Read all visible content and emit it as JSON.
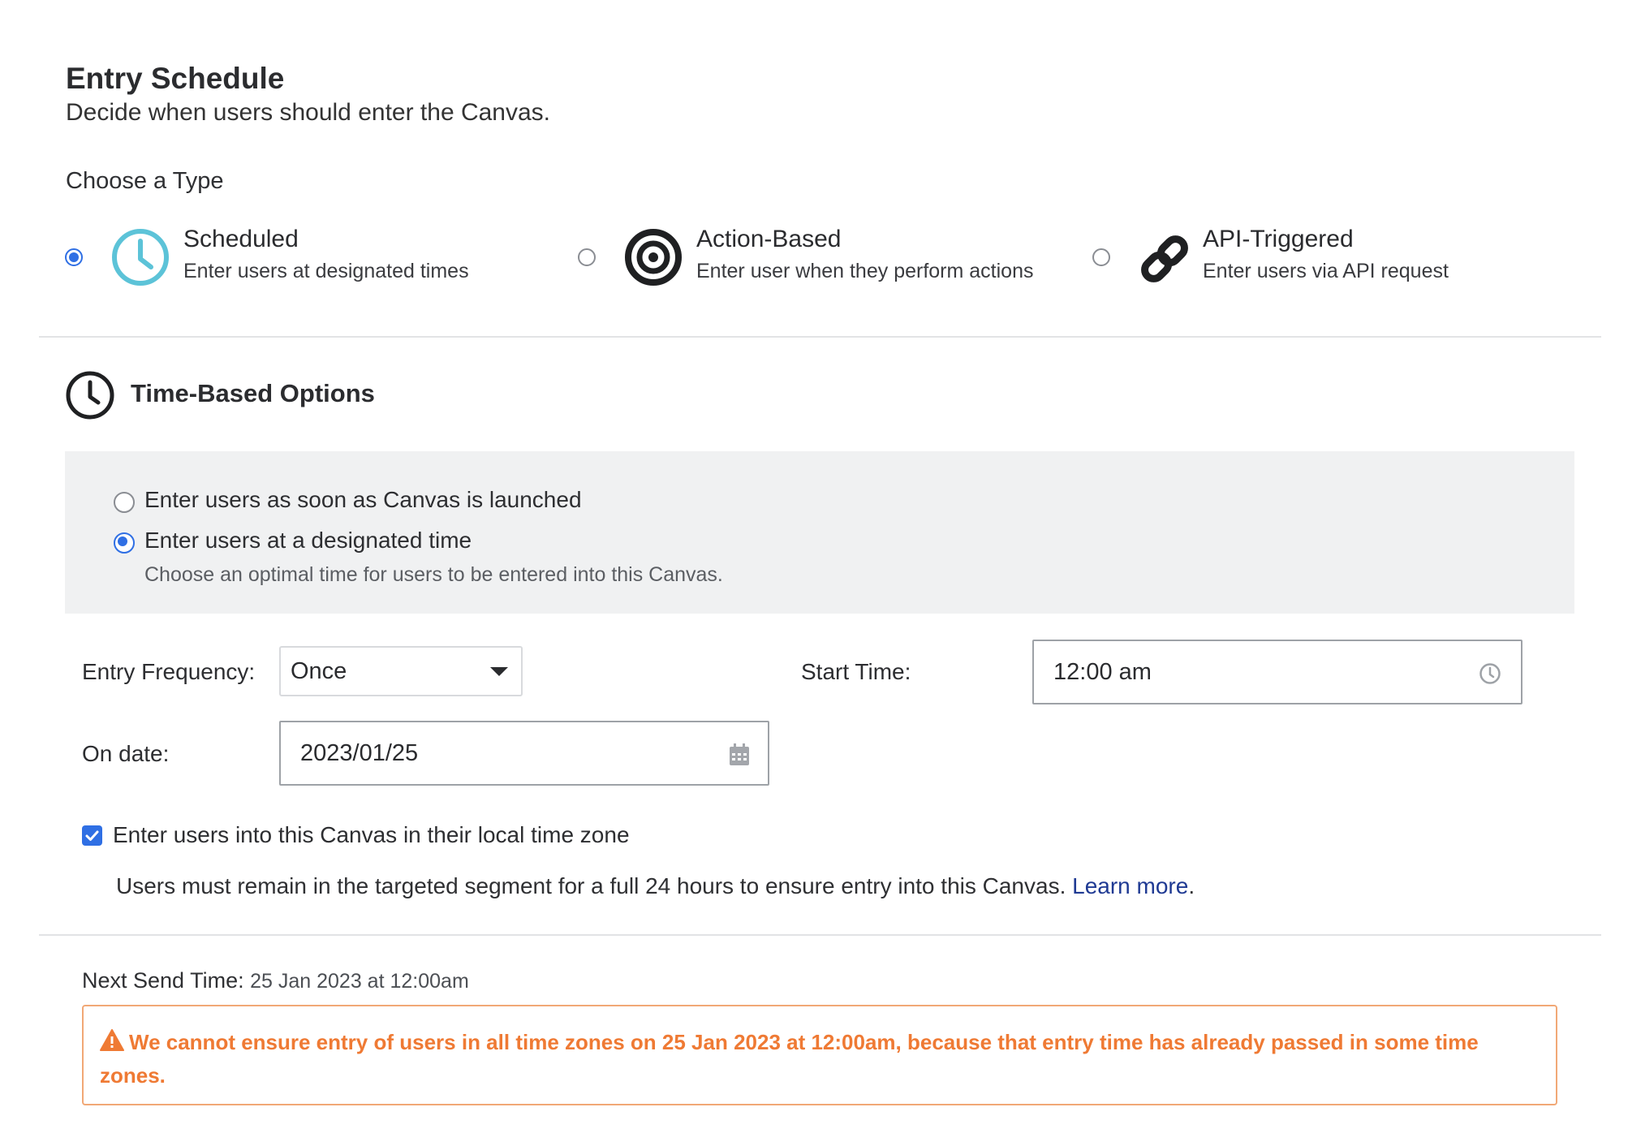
{
  "header": {
    "title": "Entry Schedule",
    "subtitle": "Decide when users should enter the Canvas."
  },
  "type_section": {
    "label": "Choose a Type",
    "options": [
      {
        "title": "Scheduled",
        "description": "Enter users at designated times",
        "icon": "clock-icon",
        "selected": true
      },
      {
        "title": "Action-Based",
        "description": "Enter user when they perform actions",
        "icon": "target-icon",
        "selected": false
      },
      {
        "title": "API-Triggered",
        "description": "Enter users via API request",
        "icon": "link-icon",
        "selected": false
      }
    ]
  },
  "time_options": {
    "title": "Time-Based Options",
    "choices": [
      {
        "label": "Enter users as soon as Canvas is launched",
        "selected": false
      },
      {
        "label": "Enter users at a designated time",
        "selected": true,
        "description": "Choose an optimal time for users to be entered into this Canvas."
      }
    ]
  },
  "form": {
    "entry_frequency_label": "Entry Frequency:",
    "entry_frequency_value": "Once",
    "start_time_label": "Start Time:",
    "start_time_value": "12:00 am",
    "on_date_label": "On date:",
    "on_date_value": "2023/01/25",
    "local_tz_label": "Enter users into this Canvas in their local time zone",
    "local_tz_checked": true,
    "note_text": "Users must remain in the targeted segment for a full 24 hours to ensure entry into this Canvas.",
    "learn_more": "Learn more",
    "note_period": "."
  },
  "next_send": {
    "label": "Next Send Time:",
    "value": "25 Jan 2023 at 12:00am"
  },
  "warning": {
    "text": "We cannot ensure entry of users in all time zones on 25 Jan 2023 at 12:00am, because that entry time has already passed in some time zones."
  },
  "colors": {
    "accent": "#2f6fe4",
    "scheduled_icon": "#5cc3d8",
    "warning": "#ef7a34",
    "warning_border": "#f1a876",
    "link": "#1f3a93",
    "panel_bg": "#f0f1f2"
  }
}
